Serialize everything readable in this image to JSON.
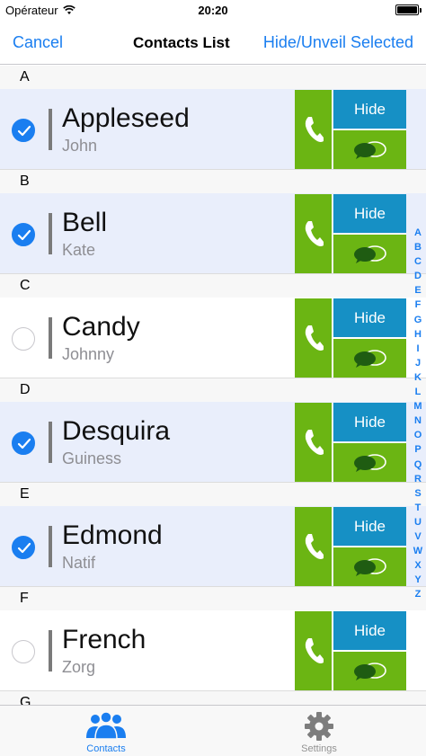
{
  "statusbar": {
    "carrier": "Opérateur",
    "time": "20:20",
    "battery_level": 1.0
  },
  "navbar": {
    "cancel": "Cancel",
    "title": "Contacts List",
    "hide_selected": "Hide/Unveil Selected"
  },
  "colors": {
    "accent": "#1a7ef0",
    "green": "#6bb513",
    "hide_blue": "#1690c5",
    "selected_row": "#e9eefb"
  },
  "sections": [
    {
      "letter": "A",
      "contacts": [
        {
          "last": "Appleseed",
          "first": "John",
          "selected": true,
          "hide_label": "Hide"
        }
      ]
    },
    {
      "letter": "B",
      "contacts": [
        {
          "last": "Bell",
          "first": "Kate",
          "selected": true,
          "hide_label": "Hide"
        }
      ]
    },
    {
      "letter": "C",
      "contacts": [
        {
          "last": "Candy",
          "first": "Johnny",
          "selected": false,
          "hide_label": "Hide"
        }
      ]
    },
    {
      "letter": "D",
      "contacts": [
        {
          "last": "Desquira",
          "first": "Guiness",
          "selected": true,
          "hide_label": "Hide"
        }
      ]
    },
    {
      "letter": "E",
      "contacts": [
        {
          "last": "Edmond",
          "first": "Natif",
          "selected": true,
          "hide_label": "Hide"
        }
      ]
    },
    {
      "letter": "F",
      "contacts": [
        {
          "last": "French",
          "first": "Zorg",
          "selected": false,
          "hide_label": "Hide"
        }
      ]
    },
    {
      "letter": "G",
      "contacts": []
    }
  ],
  "index": [
    "A",
    "B",
    "C",
    "D",
    "E",
    "F",
    "G",
    "H",
    "I",
    "J",
    "K",
    "L",
    "M",
    "N",
    "O",
    "P",
    "Q",
    "R",
    "S",
    "T",
    "U",
    "V",
    "W",
    "X",
    "Y",
    "Z"
  ],
  "icons": {
    "call": "phone-icon",
    "message": "chat-bubbles-icon",
    "check": "checkmark-icon",
    "contacts_tab": "people-icon",
    "settings_tab": "gear-icon"
  },
  "tabbar": {
    "contacts": "Contacts",
    "settings": "Settings"
  }
}
